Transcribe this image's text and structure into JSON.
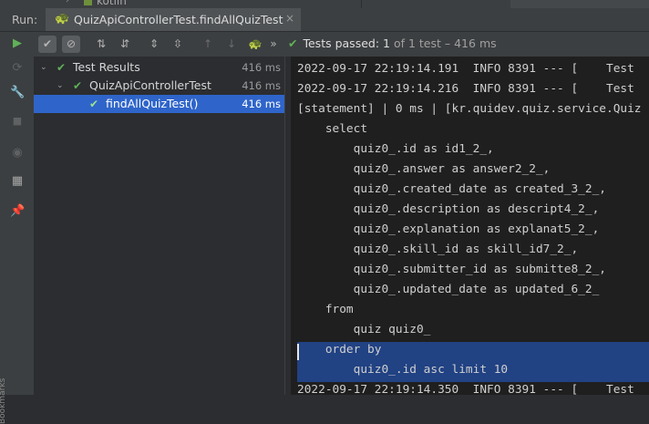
{
  "top": {
    "project_label": "kotlin"
  },
  "run_bar": {
    "label": "Run:",
    "tab_title": "QuizApiControllerTest.findAllQuizTest",
    "close_icon": "×"
  },
  "toolbar": {
    "status_label": "Tests passed:",
    "status_count": "1",
    "status_rest": " of 1 test – 416 ms",
    "more": "»"
  },
  "tree": {
    "items": [
      {
        "label": "Test Results",
        "time": "416 ms",
        "status": "passed",
        "expanded": true,
        "selected": false
      },
      {
        "label": "QuizApiControllerTest",
        "time": "416 ms",
        "status": "passed",
        "expanded": true,
        "selected": false
      },
      {
        "label": "findAllQuizTest()",
        "time": "416 ms",
        "status": "passed",
        "selected": true
      }
    ]
  },
  "console": {
    "lines": [
      "2022-09-17 22:19:14.191  INFO 8391 --- [    Test",
      "2022-09-17 22:19:14.216  INFO 8391 --- [    Test",
      "[statement] | 0 ms | [kr.quidev.quiz.service.Quiz",
      "    select",
      "        quiz0_.id as id1_2_,",
      "        quiz0_.answer as answer2_2_,",
      "        quiz0_.created_date as created_3_2_,",
      "        quiz0_.description as descript4_2_,",
      "        quiz0_.explanation as explanat5_2_,",
      "        quiz0_.skill_id as skill_id7_2_,",
      "        quiz0_.submitter_id as submitte8_2_,",
      "        quiz0_.updated_date as updated_6_2_",
      "    from",
      "        quiz quiz0_",
      "    order by",
      "        quiz0_.id asc limit 10",
      "2022-09-17 22:19:14.350  INFO 8391 --- [    Test"
    ]
  },
  "side_label": "Bookmarks"
}
